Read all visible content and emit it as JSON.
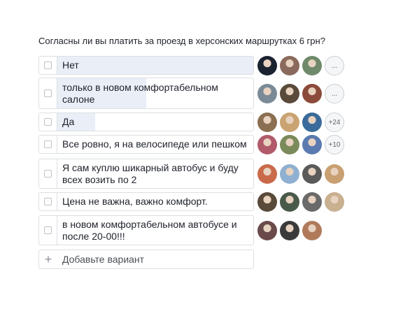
{
  "poll": {
    "question": "Согласны ли вы платить за проезд в херсонских маршрутках 6 грн?",
    "options": [
      {
        "label": "Нет",
        "share": 1.0,
        "more": "...",
        "avatars": [
          "#1b2230",
          "#8a6a5c",
          "#6f8a6a"
        ]
      },
      {
        "label": "только в новом комфортабельном салоне",
        "share": 0.5,
        "more": "...",
        "avatars": [
          "#7a8b97",
          "#5a4a3a",
          "#8b4a3a"
        ]
      },
      {
        "label": "Да",
        "share": 0.26,
        "more": "+24",
        "avatars": [
          "#8b6f52",
          "#c9a472",
          "#3b6b9a"
        ]
      },
      {
        "label": "Все ровно, я на велосипеде или пешком",
        "share": 0.06,
        "more": "+10",
        "avatars": [
          "#b05a6a",
          "#7b8a5a",
          "#5a7ab0"
        ]
      },
      {
        "label": "Я сам куплю шикарный автобус и буду всех возить по 2",
        "share": 0.06,
        "more": "",
        "avatars": [
          "#c96a4a",
          "#8fb0d0",
          "#5a5a5a",
          "#c9a072"
        ]
      },
      {
        "label": "Цена не важна, важно комфорт.",
        "share": 0.06,
        "more": "",
        "avatars": [
          "#5a4a3a",
          "#4a5a4a",
          "#6a6a6a",
          "#c9b090"
        ]
      },
      {
        "label": "в новом комфортабельном автобусе и после 20-00!!!",
        "share": 0.06,
        "more": "",
        "avatars": [
          "#6a4a4a",
          "#3a3a3a",
          "#b07a5a"
        ]
      }
    ],
    "add_option": {
      "icon": "+",
      "placeholder": "Добавьте вариант"
    }
  }
}
